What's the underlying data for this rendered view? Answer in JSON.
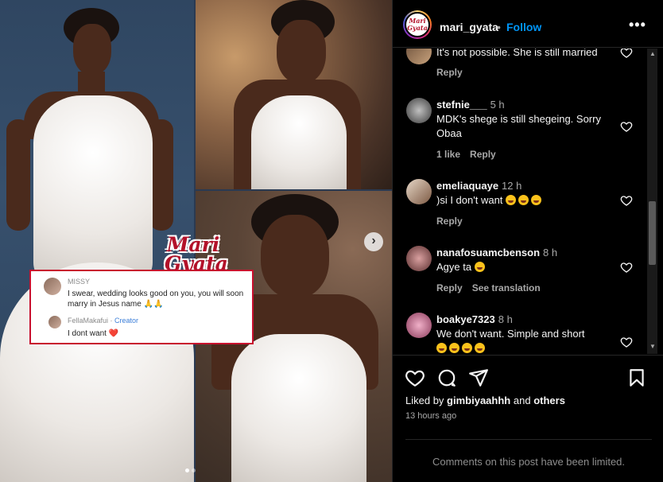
{
  "media": {
    "overlay_logo": "Mari Gyata",
    "overlay_logo_line1": "Mari",
    "overlay_logo_line2": "Gyata",
    "card": {
      "comment1_user": "MISSY",
      "comment1_text": "I swear, wedding looks good on you, you will soon marry in Jesus name",
      "comment1_emoji": "🙏🙏",
      "comment2_user": "FellaMakafui",
      "comment2_badge": "Creator",
      "comment2_text": "I dont want",
      "comment2_emoji": "❤️"
    },
    "next_icon": "chevron-right-icon",
    "slide_count": 2,
    "active_slide": 1
  },
  "header": {
    "username": "mari_gyata",
    "separator": "•",
    "follow_label": "Follow",
    "avatar_text": "Mari Gyata",
    "more_icon": "more-horizontal-icon",
    "more_label": "•••"
  },
  "comments": [
    {
      "username": "",
      "time": "",
      "text": "It's not possible. She is still married",
      "likes": "",
      "reply_label": "Reply",
      "extra": ""
    },
    {
      "username": "stefnie___",
      "time": "5 h",
      "text": "MDK's shege is still shegeing. Sorry Obaa",
      "likes": "1 like",
      "reply_label": "Reply",
      "extra": ""
    },
    {
      "username": "emeliaquaye",
      "time": "12 h",
      "text": ")si I don't want",
      "emoji": "😂 😂 😂",
      "likes": "",
      "reply_label": "Reply",
      "extra": ""
    },
    {
      "username": "nanafosuamcbenson",
      "time": "8 h",
      "text": "Agye ta",
      "emoji": "😂",
      "likes": "",
      "reply_label": "Reply",
      "extra": "See translation"
    },
    {
      "username": "boakye7323",
      "time": "8 h",
      "text": "We don't want. Simple and short",
      "emoji": "😂 😂 😂 😂",
      "likes": "",
      "reply_label": "",
      "extra": ""
    }
  ],
  "actions": {
    "like_icon": "heart-icon",
    "comment_icon": "comment-icon",
    "share_icon": "send-icon",
    "save_icon": "bookmark-icon",
    "likes_prefix": "Liked by",
    "likes_user": "gimbiyaahhh",
    "likes_and": "and",
    "likes_others": "others",
    "posted_time": "13 hours ago",
    "limited_text": "Comments on this post have been limited."
  },
  "colors": {
    "accent": "#0095f6",
    "background": "#000000",
    "brand_red": "#b3122a"
  }
}
